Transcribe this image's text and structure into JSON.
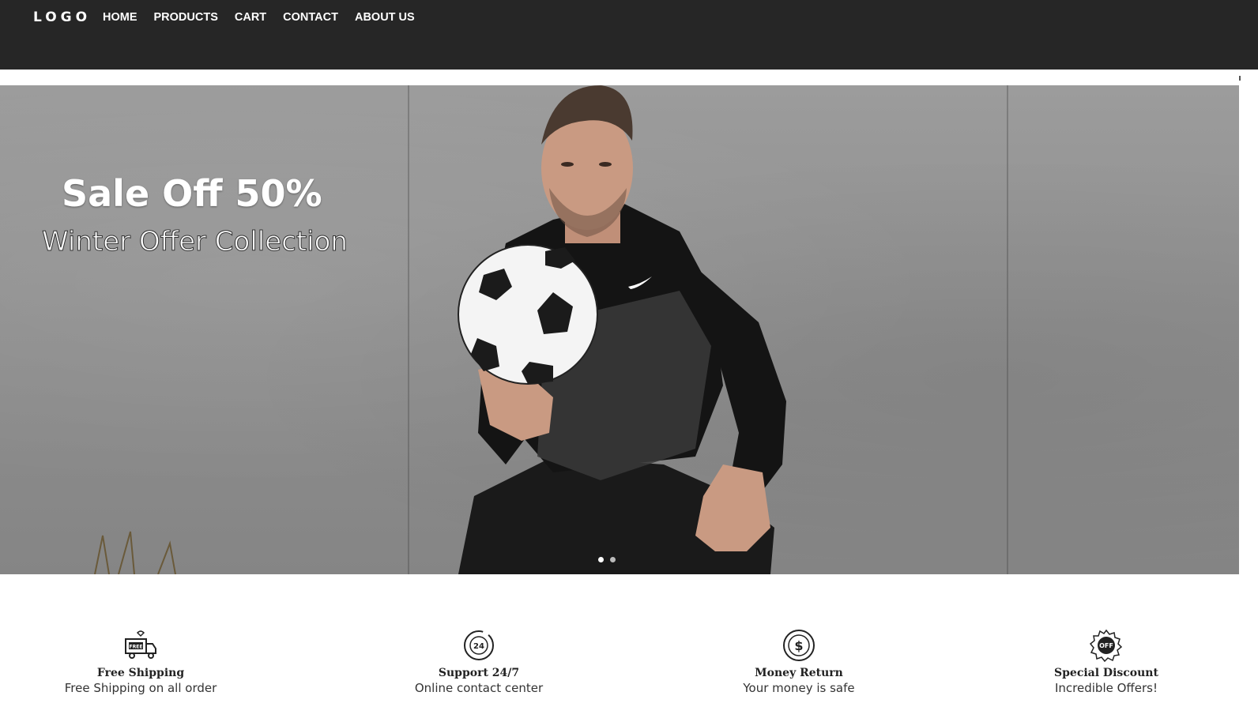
{
  "navbar": {
    "logo": "LOGO",
    "links": [
      "HOME",
      "PRODUCTS",
      "CART",
      "CONTACT",
      "ABOUT US"
    ]
  },
  "hero": {
    "title": "Sale Off 50%",
    "subtitle": "Winter Offer Collection",
    "carousel": {
      "slides": 2,
      "active": 1
    }
  },
  "features": [
    {
      "icon": "free-shipping-truck-icon",
      "title": "Free Shipping",
      "desc": "Free Shipping on all order"
    },
    {
      "icon": "support-24-icon",
      "title": "Support 24/7",
      "desc": "Online contact center"
    },
    {
      "icon": "money-return-icon",
      "title": "Money Return",
      "desc": "Your money is safe"
    },
    {
      "icon": "discount-off-badge-icon",
      "title": "Special Discount",
      "desc": "Incredible Offers!"
    }
  ],
  "colors": {
    "navbar_bg": "#262626",
    "hero_wall": "#8e8e8e",
    "text_dark": "#222222"
  }
}
